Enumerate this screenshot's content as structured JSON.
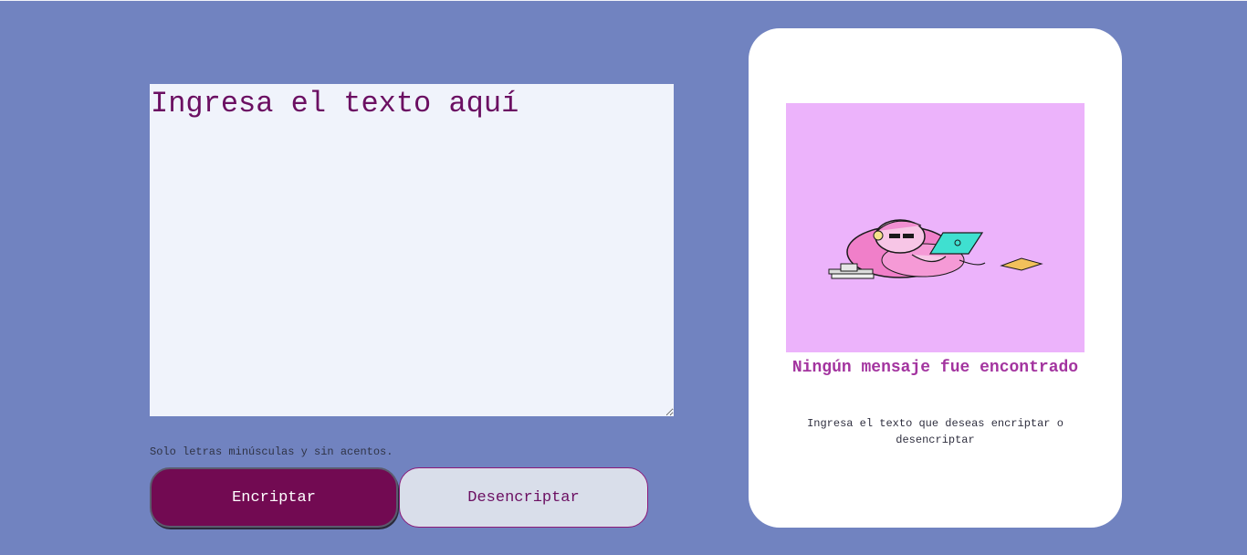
{
  "input": {
    "placeholder": "Ingresa el texto aquí",
    "value": ""
  },
  "hint": {
    "text": "Solo letras minúsculas y sin acentos.",
    "icon": "info-icon"
  },
  "buttons": {
    "encrypt_label": "Encriptar",
    "decrypt_label": "Desencriptar"
  },
  "output": {
    "illustration": "person-with-laptop-on-beanbag-illustration",
    "title": "Ningún mensaje fue encontrado",
    "text": "Ingresa el texto que deseas encriptar o desencriptar"
  },
  "colors": {
    "background": "#7183c0",
    "accent": "#720a52",
    "text_purple": "#6b0f62",
    "title_purple": "#a3349f",
    "illustration_bg": "#ecb3fb"
  }
}
